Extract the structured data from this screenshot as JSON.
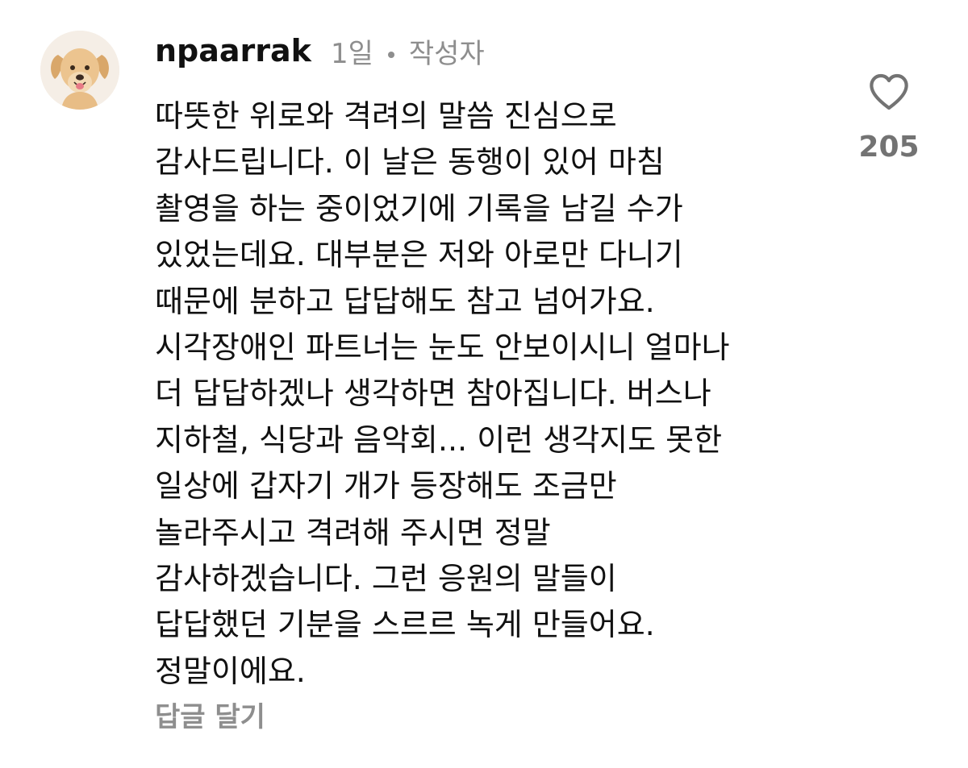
{
  "comment": {
    "username": "npaarrak",
    "time_ago": "1일",
    "author_badge": "작성자",
    "body_lines": [
      "따뜻한 위로와 격려의 말씀 진심으로",
      "감사드립니다. 이 날은 동행이 있어 마침",
      "촬영을 하는 중이었기에 기록을 남길 수가",
      "있었는데요. 대부분은 저와 아로만 다니기",
      "때문에 분하고 답답해도 참고 넘어가요.",
      "시각장애인 파트너는 눈도 안보이시니 얼마나",
      "더 답답하겠나 생각하면 참아집니다. 버스나",
      "지하철, 식당과 음악회... 이런 생각지도 못한",
      "일상에 갑자기 개가 등장해도 조금만",
      "놀라주시고 격려해 주시면 정말",
      "감사하겠습니다. 그런 응원의 말들이",
      "답답했던 기분을 스르르 녹게 만들어요.",
      "정말이에요."
    ],
    "reply_label": "답글 달기",
    "like_count": "205",
    "avatar_icon": "dog-avatar-icon",
    "like_icon": "heart-outline-icon"
  },
  "colors": {
    "text_primary": "#111111",
    "text_secondary": "#8e8e8e",
    "like_count": "#737373",
    "background": "#ffffff"
  }
}
